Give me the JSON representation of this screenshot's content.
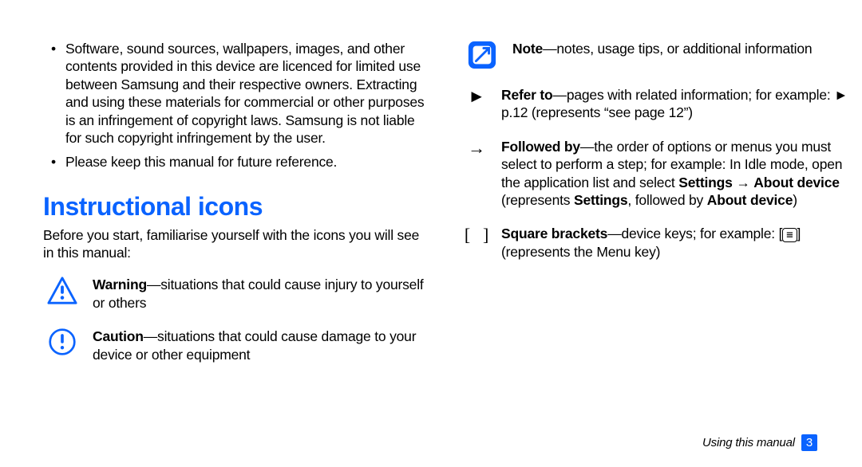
{
  "left": {
    "bullets": [
      "Software, sound sources, wallpapers, images, and other contents provided in this device are licenced for limited use between Samsung and their respective owners. Extracting and using these materials for commercial or other purposes is an infringement of copyright laws. Samsung is not liable for such copyright infringement by the user.",
      "Please keep this manual for future reference."
    ],
    "heading": "Instructional icons",
    "intro": "Before you start, familiarise yourself with the icons you will see in this manual:",
    "warning_label": "Warning",
    "warning_text": "—situations that could cause injury to yourself or others",
    "caution_label": "Caution",
    "caution_text": "—situations that could cause damage to your device or other equipment"
  },
  "right": {
    "note_label": "Note",
    "note_text": "—notes, usage tips, or additional information",
    "refer_symbol": "►",
    "refer_label": "Refer to",
    "refer_text": "—pages with related information; for example: ► p.12 (represents “see page 12”)",
    "arrow_symbol": "→",
    "followed_label": "Followed by",
    "followed_text_a": "—the order of options or menus you must select to perform a step; for example: In Idle mode, open the application list and select ",
    "followed_nav_1": "Settings",
    "followed_nav_arrow": " → ",
    "followed_nav_2": "About device",
    "followed_text_b": " (represents ",
    "followed_nav_3": "Settings",
    "followed_text_c": ", followed by ",
    "followed_nav_4": "About device",
    "followed_text_d": ")",
    "sq_symbol_l": "[",
    "sq_symbol_r": "]",
    "sq_label": "Square brackets",
    "sq_text_a": "—device keys; for example: [",
    "sq_text_b": "] (represents the Menu key)"
  },
  "footer": {
    "section": "Using this manual",
    "page": "3"
  }
}
